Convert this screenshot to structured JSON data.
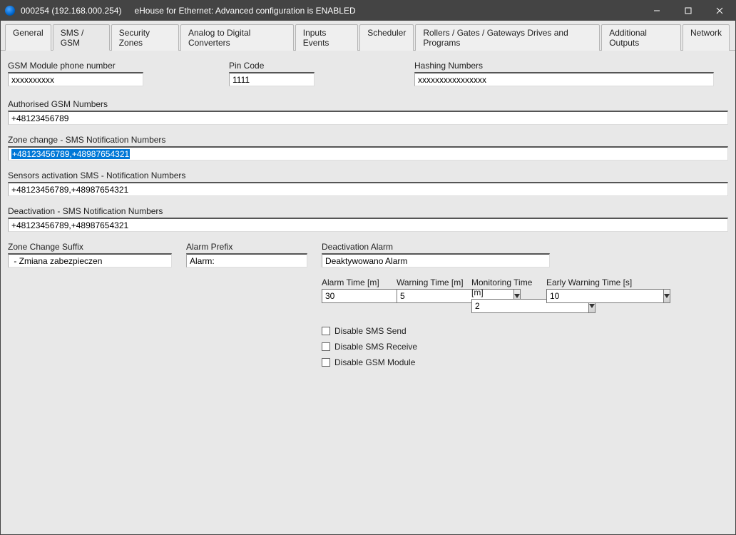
{
  "window": {
    "id_text": "000254 (192.168.000.254)",
    "subtitle": "eHouse for Ethernet: Advanced configuration is ENABLED"
  },
  "tabs": {
    "general": "General",
    "sms_gsm": "SMS / GSM",
    "security_zones": "Security Zones",
    "adc": "Analog to Digital Converters",
    "inputs_events": "Inputs Events",
    "scheduler": "Scheduler",
    "rollers": "Rollers / Gates / Gateways Drives  and Programs",
    "additional_outputs": "Additional Outputs",
    "network": "Network"
  },
  "labels": {
    "gsm_phone": "GSM Module phone number",
    "pin": "Pin Code",
    "hashing": "Hashing Numbers",
    "auth_nums": "Authorised GSM Numbers",
    "zone_change_nums": "Zone change - SMS Notification Numbers",
    "sensors_nums": "Sensors activation SMS - Notification Numbers",
    "deact_nums": "Deactivation - SMS Notification Numbers",
    "zone_suffix": "Zone Change Suffix",
    "alarm_prefix": "Alarm Prefix",
    "deact_alarm": "Deactivation Alarm",
    "alarm_time": "Alarm Time [m]",
    "warning_time": "Warning Time [m]",
    "monitoring_time": "Monitoring Time [m]",
    "early_warning": "Early Warning Time [s]",
    "disable_send": "Disable SMS Send",
    "disable_recv": "Disable SMS Receive",
    "disable_mod": "Disable GSM Module"
  },
  "values": {
    "gsm_phone": "xxxxxxxxxx",
    "pin": "1111",
    "hashing": "xxxxxxxxxxxxxxxx",
    "auth_nums": "+48123456789",
    "zone_change_nums": "+48123456789,+48987654321",
    "sensors_nums": "+48123456789,+48987654321",
    "deact_nums": "+48123456789,+48987654321",
    "zone_suffix": " - Zmiana zabezpieczen",
    "alarm_prefix": "Alarm:",
    "deact_alarm": "Deaktywowano Alarm",
    "alarm_time": "30",
    "warning_time": "5",
    "monitoring_time": "2",
    "early_warning": "10"
  }
}
